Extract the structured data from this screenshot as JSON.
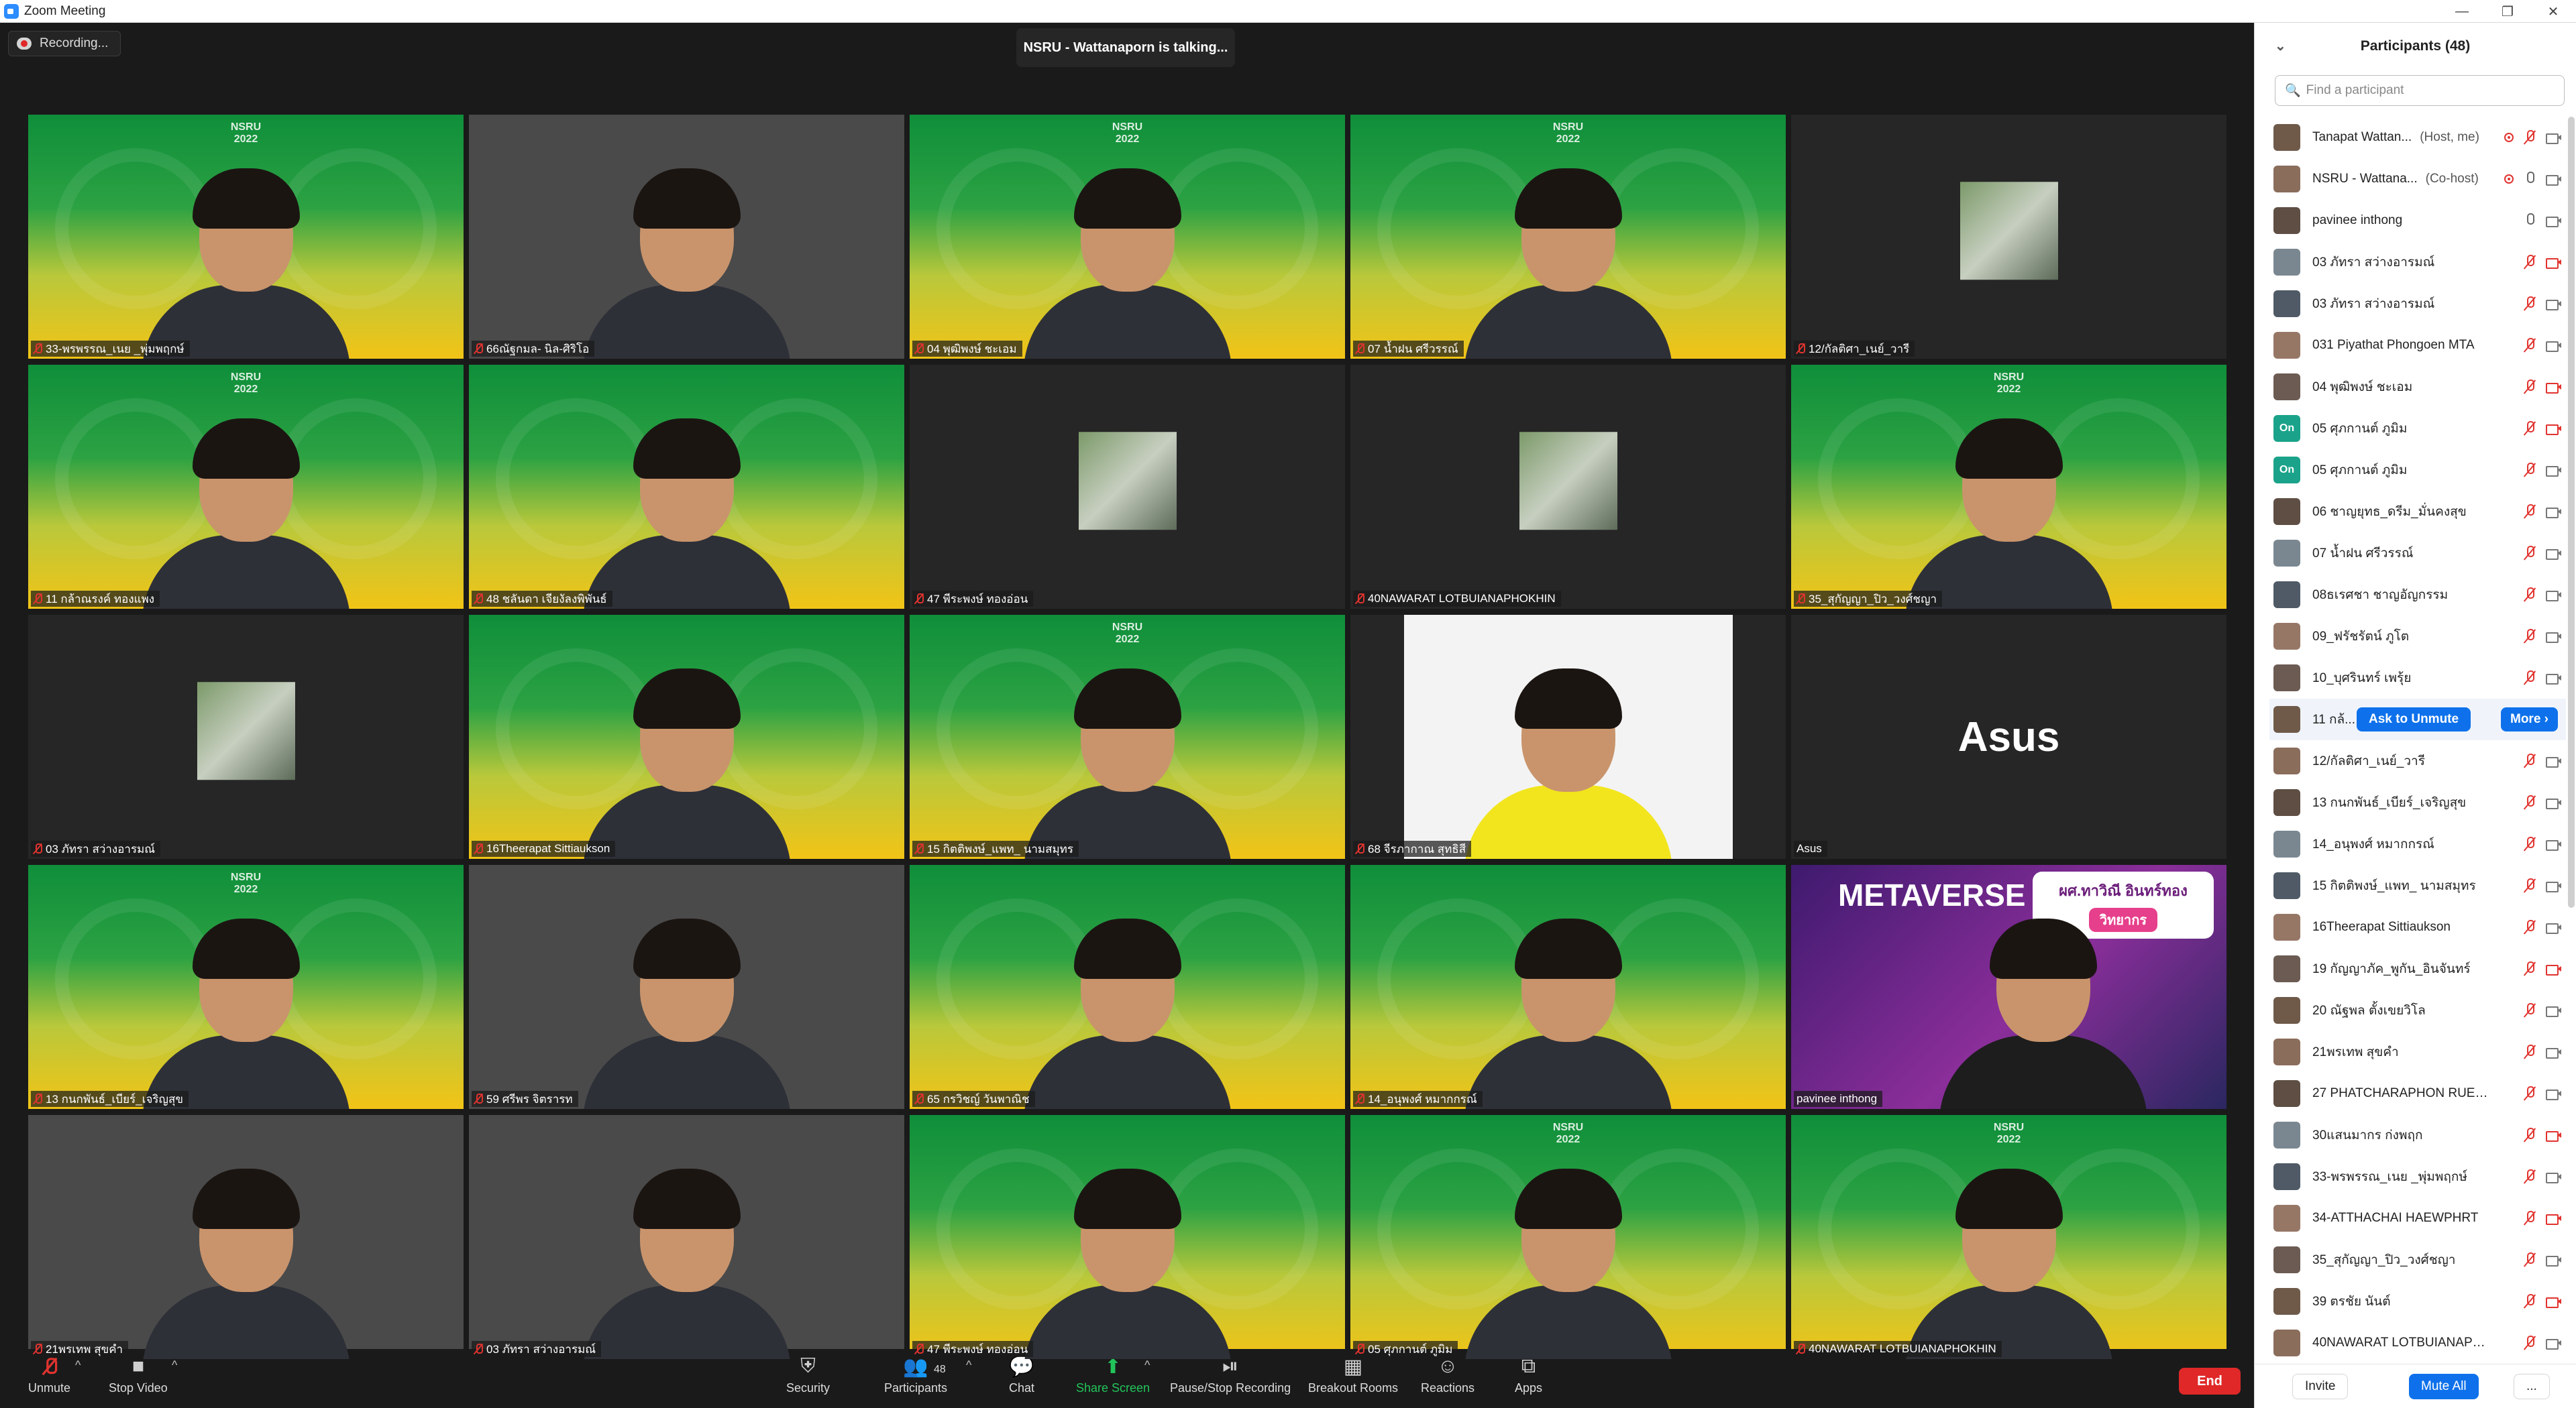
{
  "window": {
    "title": "Zoom Meeting",
    "minimize": "—",
    "restore": "❐",
    "close": "✕"
  },
  "recording": {
    "label": "Recording..."
  },
  "banner": {
    "talking": "NSRU - Wattanaporn is talking..."
  },
  "tiles": [
    {
      "name": "33-พรพรรณ_เนย _พุ่มพฤกษ์",
      "type": "green",
      "logo": "NSRU\n2022"
    },
    {
      "name": "66ณัฐกมล- นิล-ศิริโอ",
      "type": "cam"
    },
    {
      "name": "04 พุฒิพงษ์ ชะเอม",
      "type": "green",
      "logo": "NSRU\n2022"
    },
    {
      "name": "07 น้ำฝน ศรีวรรณ์",
      "type": "green",
      "logo": "NSRU\n2022"
    },
    {
      "name": "12/กัลติศา_เนย์_วารี",
      "type": "photo"
    },
    {
      "name": "11 กล้าณรงค์ ทองแพง",
      "type": "green",
      "logo": "NSRU\n2022"
    },
    {
      "name": "48 ชลันดา เจียงัลงพิพันธ์",
      "type": "green"
    },
    {
      "name": "47 พีระพงษ์ ทองอ่อน",
      "type": "photo"
    },
    {
      "name": "40NAWARAT LOTBUIANAPHOKHIN",
      "type": "photo"
    },
    {
      "name": "35_สุกัญญา_ปิว_วงศ์ชญา",
      "type": "green",
      "logo": "NSRU\n2022"
    },
    {
      "name": "03 ภัทรา สว่างอารมณ์",
      "type": "photo"
    },
    {
      "name": "16Theerapat Sittiaukson",
      "type": "green"
    },
    {
      "name": "15 กิตติพงษ์_แพท_ นามสมุทร",
      "type": "green",
      "logo": "NSRU\n2022"
    },
    {
      "name": "68 จีรภากาณ สุทธิสี",
      "type": "yellow"
    },
    {
      "name": "Asus",
      "type": "name",
      "big": "Asus"
    },
    {
      "name": "13 กนกพันธ์_เบียร์_เจริญสุข",
      "type": "green",
      "logo": "NSRU\n2022"
    },
    {
      "name": "59 ศรีพร จิตรารท",
      "type": "cam"
    },
    {
      "name": "65 กรวิชญ์ วันพาณิช",
      "type": "green"
    },
    {
      "name": "14_อนุพงศ์ หมากกรณ์",
      "type": "green"
    },
    {
      "name": "pavinee inthong",
      "type": "metaverse",
      "banner": "METAVERSE",
      "speaker": "ผศ.ทาวิณี อินทร์ทอง",
      "role": "วิทยากร"
    },
    {
      "name": "21พรเทพ สุขคำ",
      "type": "cam"
    },
    {
      "name": "03 ภัทรา สว่างอารมณ์",
      "type": "cam"
    },
    {
      "name": "47 พีระพงษ์ ทองอ่อน",
      "type": "green"
    },
    {
      "name": "05 ศุภกานต์ ภูมิม",
      "type": "green",
      "logo": "NSRU\n2022"
    },
    {
      "name": "40NAWARAT LOTBUIANAPHOKHIN",
      "type": "green",
      "logo": "NSRU\n2022"
    }
  ],
  "toolbar": {
    "unmute": "Unmute",
    "stop_video": "Stop Video",
    "security": "Security",
    "participants": "Participants",
    "participants_count": "48",
    "chat": "Chat",
    "share_screen": "Share Screen",
    "recording": "Pause/Stop Recording",
    "breakout": "Breakout Rooms",
    "reactions": "Reactions",
    "apps": "Apps",
    "end": "End"
  },
  "panel": {
    "title": "Participants (48)",
    "search_placeholder": "Find a participant",
    "invite": "Invite",
    "mute_all": "Mute All",
    "more": "...",
    "ask_to_unmute": "Ask to Unmute",
    "more_btn": "More ›",
    "participants": [
      {
        "name": "Tanapat Wattan...",
        "role": "(Host, me)",
        "avatar": "photo",
        "mic": "off",
        "video": "on",
        "share": true
      },
      {
        "name": "NSRU - Wattana...",
        "role": "(Co-host)",
        "avatar": "photo",
        "mic": "on",
        "video": "on",
        "share": true
      },
      {
        "name": "pavinee inthong",
        "role": "",
        "avatar": "photo",
        "mic": "on",
        "video": "on"
      },
      {
        "name": "03 ภัทรา สว่างอารมณ์",
        "role": "",
        "avatar": "photo",
        "mic": "off",
        "video": "off"
      },
      {
        "name": "03 ภัทรา สว่างอารมณ์",
        "role": "",
        "avatar": "photo",
        "mic": "off",
        "video": "on"
      },
      {
        "name": "031 Piyathat Phongoen MTA",
        "role": "",
        "avatar": "photo",
        "mic": "off",
        "video": "on"
      },
      {
        "name": "04 พุฒิพงษ์ ชะเอม",
        "role": "",
        "avatar": "photo",
        "mic": "off",
        "video": "off"
      },
      {
        "name": "05 ศุภกานต์ ภูมิม",
        "role": "",
        "avatar": "On",
        "mic": "off",
        "video": "off"
      },
      {
        "name": "05 ศุภกานต์ ภูมิม",
        "role": "",
        "avatar": "On",
        "mic": "off",
        "video": "on"
      },
      {
        "name": "06 ชาญยุทธ_ดรีม_มั่นคงสุข",
        "role": "",
        "avatar": "photo",
        "mic": "off",
        "video": "on"
      },
      {
        "name": "07 น้ำฝน ศรีวรรณ์",
        "role": "",
        "avatar": "photo",
        "mic": "off",
        "video": "on"
      },
      {
        "name": "08ธเรศชา ชาญอัญกรรม",
        "role": "",
        "avatar": "photo",
        "mic": "off",
        "video": "on"
      },
      {
        "name": "09_ฟรัชรัตน์ ภูโต",
        "role": "",
        "avatar": "photo",
        "mic": "off",
        "video": "on"
      },
      {
        "name": "10_บุศรินทร์ เพรุ้ย",
        "role": "",
        "avatar": "photo",
        "mic": "off",
        "video": "on"
      },
      {
        "name": "11 กล้...",
        "role": "",
        "avatar": "photo",
        "mic": "off",
        "video": "on",
        "hover": true
      },
      {
        "name": "12/กัลติศา_เนย์_วารี",
        "role": "",
        "avatar": "photo",
        "mic": "off",
        "video": "on"
      },
      {
        "name": "13 กนกพันธ์_เบียร์_เจริญสุข",
        "role": "",
        "avatar": "photo",
        "mic": "off",
        "video": "on"
      },
      {
        "name": "14_อนุพงศ์ หมากกรณ์",
        "role": "",
        "avatar": "photo",
        "mic": "off",
        "video": "on"
      },
      {
        "name": "15 กิตติพงษ์_แพท_ นามสมุทร",
        "role": "",
        "avatar": "photo",
        "mic": "off",
        "video": "on"
      },
      {
        "name": "16Theerapat Sittiaukson",
        "role": "",
        "avatar": "photo",
        "mic": "off",
        "video": "on"
      },
      {
        "name": "19 กัญญาภัค_พูกัน_อินจันทร์",
        "role": "",
        "avatar": "photo",
        "mic": "off",
        "video": "off"
      },
      {
        "name": "20 ณัฐพล ตั้งเขยวิโล",
        "role": "",
        "avatar": "photo",
        "mic": "off",
        "video": "on"
      },
      {
        "name": "21พรเทพ สุขคำ",
        "role": "",
        "avatar": "photo",
        "mic": "off",
        "video": "on"
      },
      {
        "name": "27 PHATCHARAPHON RUEANG...",
        "role": "",
        "avatar": "photo",
        "mic": "off",
        "video": "on"
      },
      {
        "name": "30แสนมากร ก่งพฤก",
        "role": "",
        "avatar": "photo",
        "mic": "off",
        "video": "off"
      },
      {
        "name": "33-พรพรรณ_เนย _พุ่มพฤกษ์",
        "role": "",
        "avatar": "photo",
        "mic": "off",
        "video": "on"
      },
      {
        "name": "34-ATTHACHAI HAEWPHRT",
        "role": "",
        "avatar": "photo",
        "mic": "off",
        "video": "off"
      },
      {
        "name": "35_สุกัญญา_ปิว_วงศ์ชญา",
        "role": "",
        "avatar": "photo",
        "mic": "off",
        "video": "on"
      },
      {
        "name": "39 ตรชัย นันต์",
        "role": "",
        "avatar": "photo",
        "mic": "off",
        "video": "off"
      },
      {
        "name": "40NAWARAT LOTBUIANAPHOK...",
        "role": "",
        "avatar": "photo",
        "mic": "off",
        "video": "on"
      }
    ]
  }
}
